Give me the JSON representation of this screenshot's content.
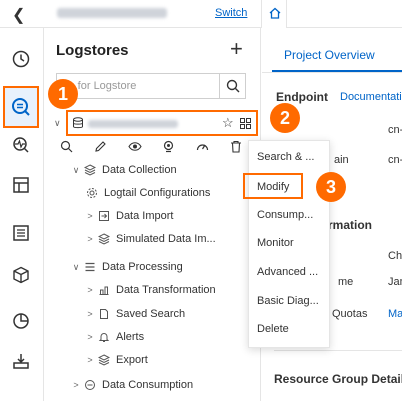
{
  "topbar": {
    "back_icon": "chevron-left-icon",
    "switch_label": "Switch"
  },
  "panel": {
    "title": "Logstores",
    "search_placeholder": "Search for Logstore",
    "search_visible_text": "ch for Logstore",
    "tree": {
      "data_collection": "Data Collection",
      "logtail_configurations": "Logtail Configurations",
      "data_import": "Data Import",
      "simulated_data_import": "Simulated Data Im...",
      "data_processing": "Data Processing",
      "data_transformation": "Data Transformation",
      "saved_search": "Saved Search",
      "alerts": "Alerts",
      "export": "Export",
      "data_consumption": "Data Consumption"
    }
  },
  "menu": {
    "items": [
      "Search & ...",
      "Modify",
      "Consump...",
      "Monitor",
      "Advanced ...",
      "Basic Diag...",
      "Delete"
    ]
  },
  "badges": [
    "1",
    "2",
    "3"
  ],
  "right": {
    "tab": "Project Overview",
    "endpoint": "Endpoint",
    "documentation": "Documentatio",
    "cn1": "cn-",
    "ain": "ain",
    "cn2": "cn-",
    "rmation": "rmation",
    "chi": "Chi",
    "me": "me",
    "jan": "Jan",
    "quotas": "Quotas",
    "ma": "Ma",
    "resource_group": "Resource Group Detail"
  },
  "colors": {
    "accent": "#ff6a00",
    "link": "#0064c8"
  }
}
